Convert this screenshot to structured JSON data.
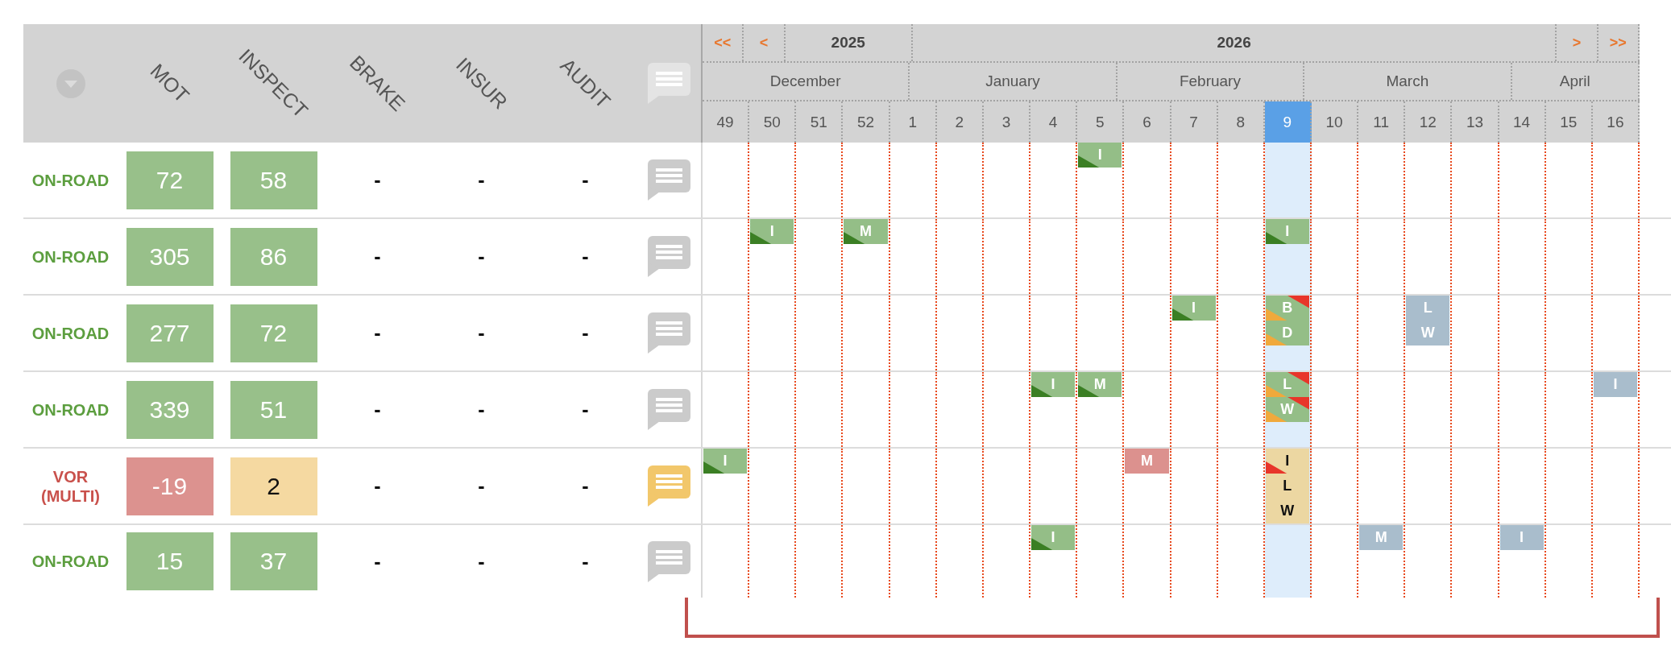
{
  "columns": [
    "MOT",
    "INSPECT",
    "BRAKE",
    "INSUR",
    "AUDIT"
  ],
  "timeline": {
    "years": [
      {
        "kind": "nav",
        "text": "<<"
      },
      {
        "kind": "nav",
        "text": "<"
      },
      {
        "kind": "year",
        "text": "2025"
      },
      {
        "kind": "year",
        "text": "2026"
      },
      {
        "kind": "nav",
        "text": ">"
      },
      {
        "kind": "nav",
        "text": ">>"
      }
    ],
    "months": [
      "December",
      "January",
      "February",
      "March",
      "April"
    ],
    "weeks": [
      {
        "label": "49",
        "selected": false
      },
      {
        "label": "50",
        "selected": false
      },
      {
        "label": "51",
        "selected": false
      },
      {
        "label": "52",
        "selected": false
      },
      {
        "label": "1",
        "selected": false
      },
      {
        "label": "2",
        "selected": false
      },
      {
        "label": "3",
        "selected": false
      },
      {
        "label": "4",
        "selected": false
      },
      {
        "label": "5",
        "selected": false
      },
      {
        "label": "6",
        "selected": false
      },
      {
        "label": "7",
        "selected": false
      },
      {
        "label": "8",
        "selected": false
      },
      {
        "label": "9",
        "selected": true
      },
      {
        "label": "10",
        "selected": false
      },
      {
        "label": "11",
        "selected": false
      },
      {
        "label": "12",
        "selected": false
      },
      {
        "label": "13",
        "selected": false
      },
      {
        "label": "14",
        "selected": false
      },
      {
        "label": "15",
        "selected": false
      },
      {
        "label": "16",
        "selected": false
      }
    ]
  },
  "rows": [
    {
      "status": {
        "text": "ON-ROAD",
        "color": "#5c9e3f"
      },
      "values": [
        {
          "kind": "tile",
          "text": "72",
          "color": "#98c08a"
        },
        {
          "kind": "tile",
          "text": "58",
          "color": "#98c08a"
        },
        {
          "kind": "plain",
          "text": "-"
        },
        {
          "kind": "plain",
          "text": "-"
        },
        {
          "kind": "plain",
          "text": "-"
        }
      ],
      "has_note": false,
      "weeks": [
        {
          "current": false
        },
        {
          "current": false
        },
        {
          "current": false
        },
        {
          "current": false
        },
        {
          "current": false
        },
        {
          "current": false
        },
        {
          "current": false
        },
        {
          "current": false
        },
        {
          "current": false,
          "events": [
            {
              "label": "I",
              "color": "#94be87",
              "corners": [
                {
                  "kind": "lower",
                  "color": "#3b7f24"
                }
              ]
            }
          ]
        },
        {
          "current": false
        },
        {
          "current": false
        },
        {
          "current": false
        },
        {
          "current": true
        },
        {
          "current": false
        },
        {
          "current": false
        },
        {
          "current": false
        },
        {
          "current": false
        },
        {
          "current": false
        },
        {
          "current": false
        },
        {
          "current": false
        }
      ]
    },
    {
      "status": {
        "text": "ON-ROAD",
        "color": "#5c9e3f"
      },
      "values": [
        {
          "kind": "tile",
          "text": "305",
          "color": "#98c08a"
        },
        {
          "kind": "tile",
          "text": "86",
          "color": "#98c08a"
        },
        {
          "kind": "plain",
          "text": "-"
        },
        {
          "kind": "plain",
          "text": "-"
        },
        {
          "kind": "plain",
          "text": "-"
        }
      ],
      "has_note": false,
      "weeks": [
        {
          "current": false
        },
        {
          "current": false,
          "events": [
            {
              "label": "I",
              "color": "#94be87",
              "corners": [
                {
                  "kind": "lower",
                  "color": "#3b7f24"
                }
              ]
            }
          ]
        },
        {
          "current": false
        },
        {
          "current": false,
          "events": [
            {
              "label": "M",
              "color": "#94be87",
              "corners": [
                {
                  "kind": "lower",
                  "color": "#3b7f24"
                }
              ]
            }
          ]
        },
        {
          "current": false
        },
        {
          "current": false
        },
        {
          "current": false
        },
        {
          "current": false
        },
        {
          "current": false
        },
        {
          "current": false
        },
        {
          "current": false
        },
        {
          "current": false
        },
        {
          "current": true,
          "events": [
            {
              "label": "I",
              "color": "#94be87",
              "corners": [
                {
                  "kind": "lower",
                  "color": "#3b7f24"
                }
              ]
            }
          ]
        },
        {
          "current": false
        },
        {
          "current": false
        },
        {
          "current": false
        },
        {
          "current": false
        },
        {
          "current": false
        },
        {
          "current": false
        },
        {
          "current": false
        }
      ]
    },
    {
      "status": {
        "text": "ON-ROAD",
        "color": "#5c9e3f"
      },
      "values": [
        {
          "kind": "tile",
          "text": "277",
          "color": "#98c08a"
        },
        {
          "kind": "tile",
          "text": "72",
          "color": "#98c08a"
        },
        {
          "kind": "plain",
          "text": "-"
        },
        {
          "kind": "plain",
          "text": "-"
        },
        {
          "kind": "plain",
          "text": "-"
        }
      ],
      "has_note": false,
      "weeks": [
        {
          "current": false
        },
        {
          "current": false
        },
        {
          "current": false
        },
        {
          "current": false
        },
        {
          "current": false
        },
        {
          "current": false
        },
        {
          "current": false
        },
        {
          "current": false
        },
        {
          "current": false
        },
        {
          "current": false
        },
        {
          "current": false,
          "events": [
            {
              "label": "I",
              "color": "#94be87",
              "corners": [
                {
                  "kind": "lower",
                  "color": "#3b7f24"
                }
              ]
            }
          ]
        },
        {
          "current": false
        },
        {
          "current": true,
          "events": [
            {
              "label": "B",
              "color": "#94be87",
              "corners": [
                {
                  "kind": "lower",
                  "color": "#f0a93c"
                },
                {
                  "kind": "upper",
                  "color": "#e8352a"
                }
              ]
            },
            {
              "label": "D",
              "color": "#94be87",
              "corners": [
                {
                  "kind": "lower",
                  "color": "#f0a93c"
                }
              ]
            }
          ]
        },
        {
          "current": false
        },
        {
          "current": false
        },
        {
          "current": false,
          "events": [
            {
              "label": "L",
              "color": "#a9bdcc"
            },
            {
              "label": "W",
              "color": "#a9bdcc"
            }
          ]
        },
        {
          "current": false
        },
        {
          "current": false
        },
        {
          "current": false
        },
        {
          "current": false
        }
      ]
    },
    {
      "status": {
        "text": "ON-ROAD",
        "color": "#5c9e3f"
      },
      "values": [
        {
          "kind": "tile",
          "text": "339",
          "color": "#98c08a"
        },
        {
          "kind": "tile",
          "text": "51",
          "color": "#98c08a"
        },
        {
          "kind": "plain",
          "text": "-"
        },
        {
          "kind": "plain",
          "text": "-"
        },
        {
          "kind": "plain",
          "text": "-"
        }
      ],
      "has_note": false,
      "weeks": [
        {
          "current": false
        },
        {
          "current": false
        },
        {
          "current": false
        },
        {
          "current": false
        },
        {
          "current": false
        },
        {
          "current": false
        },
        {
          "current": false
        },
        {
          "current": false,
          "events": [
            {
              "label": "I",
              "color": "#94be87",
              "corners": [
                {
                  "kind": "lower",
                  "color": "#3b7f24"
                }
              ]
            }
          ]
        },
        {
          "current": false,
          "events": [
            {
              "label": "M",
              "color": "#94be87",
              "corners": [
                {
                  "kind": "lower",
                  "color": "#3b7f24"
                }
              ]
            }
          ]
        },
        {
          "current": false
        },
        {
          "current": false
        },
        {
          "current": false
        },
        {
          "current": true,
          "events": [
            {
              "label": "L",
              "color": "#94be87",
              "corners": [
                {
                  "kind": "lower",
                  "color": "#f0a93c"
                },
                {
                  "kind": "upper",
                  "color": "#e8352a"
                }
              ]
            },
            {
              "label": "W",
              "color": "#94be87",
              "corners": [
                {
                  "kind": "lower",
                  "color": "#f0a93c"
                },
                {
                  "kind": "upper",
                  "color": "#e8352a"
                }
              ]
            }
          ]
        },
        {
          "current": false
        },
        {
          "current": false
        },
        {
          "current": false
        },
        {
          "current": false
        },
        {
          "current": false
        },
        {
          "current": false
        },
        {
          "current": false,
          "events": [
            {
              "label": "I",
              "color": "#a9bdcc"
            }
          ]
        }
      ]
    },
    {
      "status": {
        "text": "VOR (MULTI)",
        "color": "#c9514c"
      },
      "values": [
        {
          "kind": "tile",
          "text": "-19",
          "color": "#dc928f"
        },
        {
          "kind": "tile",
          "text": "2",
          "color": "#f5d9a1"
        },
        {
          "kind": "plain",
          "text": "-"
        },
        {
          "kind": "plain",
          "text": "-"
        },
        {
          "kind": "plain",
          "text": "-"
        }
      ],
      "has_note": true,
      "weeks": [
        {
          "current": false,
          "events": [
            {
              "label": "I",
              "color": "#94be87",
              "corners": [
                {
                  "kind": "lower",
                  "color": "#3b7f24"
                }
              ]
            }
          ]
        },
        {
          "current": false
        },
        {
          "current": false
        },
        {
          "current": false
        },
        {
          "current": false
        },
        {
          "current": false
        },
        {
          "current": false
        },
        {
          "current": false
        },
        {
          "current": false
        },
        {
          "current": false,
          "events": [
            {
              "label": "M",
              "color": "#dc918e"
            }
          ]
        },
        {
          "current": false
        },
        {
          "current": false
        },
        {
          "current": true,
          "events": [
            {
              "label": "I",
              "color": "#ecd7a2",
              "corners": [
                {
                  "kind": "lower",
                  "color": "#e8352a"
                }
              ]
            },
            {
              "label": "L",
              "color": "#ecd7a2"
            },
            {
              "label": "W",
              "color": "#ecd7a2"
            }
          ]
        },
        {
          "current": false
        },
        {
          "current": false
        },
        {
          "current": false
        },
        {
          "current": false
        },
        {
          "current": false
        },
        {
          "current": false
        },
        {
          "current": false
        }
      ]
    },
    {
      "status": {
        "text": "ON-ROAD",
        "color": "#5c9e3f"
      },
      "values": [
        {
          "kind": "tile",
          "text": "15",
          "color": "#98c08a"
        },
        {
          "kind": "tile",
          "text": "37",
          "color": "#98c08a"
        },
        {
          "kind": "plain",
          "text": "-"
        },
        {
          "kind": "plain",
          "text": "-"
        },
        {
          "kind": "plain",
          "text": "-"
        }
      ],
      "has_note": false,
      "weeks": [
        {
          "current": false
        },
        {
          "current": false
        },
        {
          "current": false
        },
        {
          "current": false
        },
        {
          "current": false
        },
        {
          "current": false
        },
        {
          "current": false
        },
        {
          "current": false,
          "events": [
            {
              "label": "I",
              "color": "#94be87",
              "corners": [
                {
                  "kind": "lower",
                  "color": "#3b7f24"
                }
              ]
            }
          ]
        },
        {
          "current": false
        },
        {
          "current": false
        },
        {
          "current": false
        },
        {
          "current": false
        },
        {
          "current": true
        },
        {
          "current": false
        },
        {
          "current": false,
          "events": [
            {
              "label": "M",
              "color": "#a9bdcc"
            }
          ]
        },
        {
          "current": false
        },
        {
          "current": false
        },
        {
          "current": false,
          "events": [
            {
              "label": "I",
              "color": "#a9bdcc"
            }
          ]
        },
        {
          "current": false
        },
        {
          "current": false
        }
      ]
    }
  ]
}
